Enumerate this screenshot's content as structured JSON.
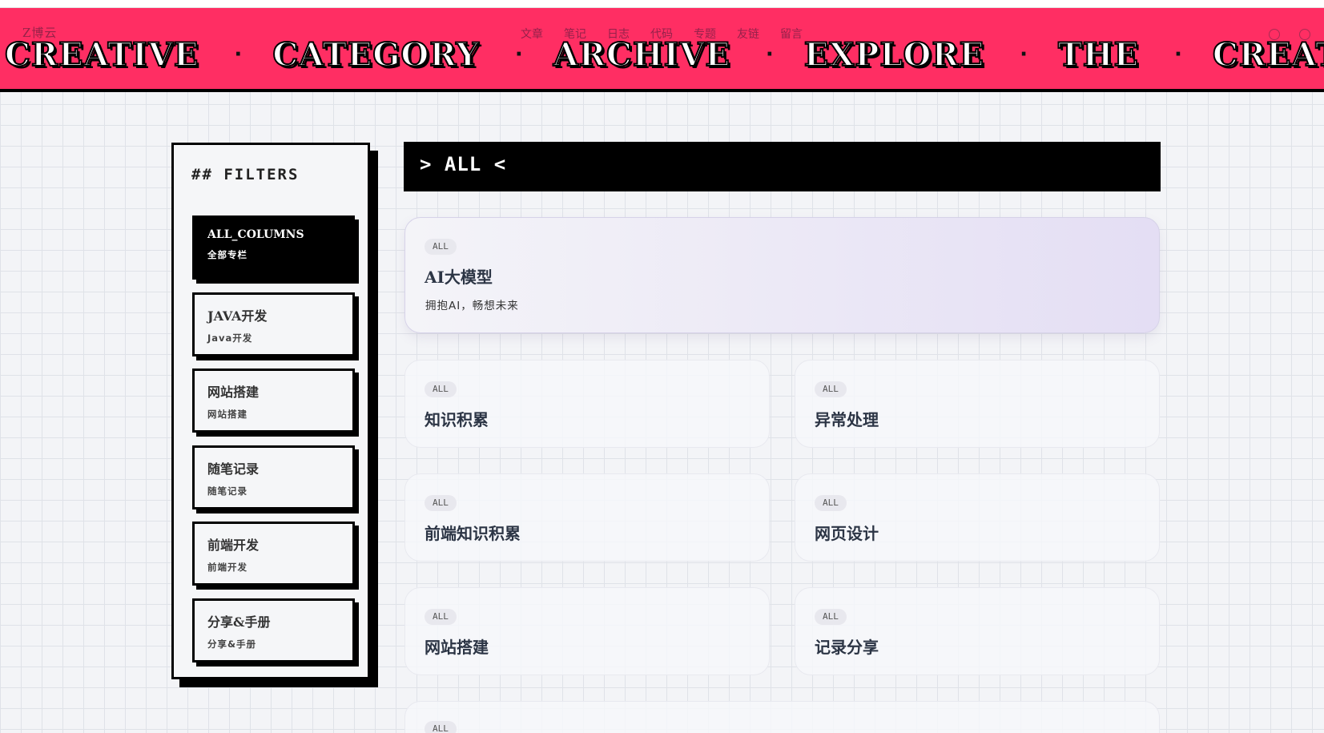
{
  "banner": {
    "words": [
      "CREATIVE",
      "CATEGORY",
      "ARCHIVE",
      "EXPLORE",
      "THE",
      "CREATIVE"
    ],
    "separator": "·",
    "brand_ghost": "Z博云",
    "nav_links": [
      "文章",
      "笔记",
      "日志",
      "代码",
      "专题",
      "友链",
      "留言"
    ],
    "color": "#ff2e63"
  },
  "sidebar": {
    "title": "## FILTERS",
    "filters": [
      {
        "label": "ALL_COLUMNS",
        "sub": "全部专栏",
        "active": true
      },
      {
        "label": "JAVA开发",
        "sub": "Java开发",
        "active": false
      },
      {
        "label": "网站搭建",
        "sub": "网站搭建",
        "active": false
      },
      {
        "label": "随笔记录",
        "sub": "随笔记录",
        "active": false
      },
      {
        "label": "前端开发",
        "sub": "前端开发",
        "active": false
      },
      {
        "label": "分享&手册",
        "sub": "分享&手册",
        "active": false
      }
    ]
  },
  "header": {
    "text": "> ALL <"
  },
  "cards": [
    {
      "badge": "ALL",
      "title": "AI大模型",
      "desc": "拥抱AI，畅想未来"
    },
    {
      "badge": "ALL",
      "title": "知识积累"
    },
    {
      "badge": "ALL",
      "title": "异常处理"
    },
    {
      "badge": "ALL",
      "title": "前端知识积累"
    },
    {
      "badge": "ALL",
      "title": "网页设计"
    },
    {
      "badge": "ALL",
      "title": "网站搭建"
    },
    {
      "badge": "ALL",
      "title": "记录分享"
    },
    {
      "badge": "ALL"
    }
  ]
}
